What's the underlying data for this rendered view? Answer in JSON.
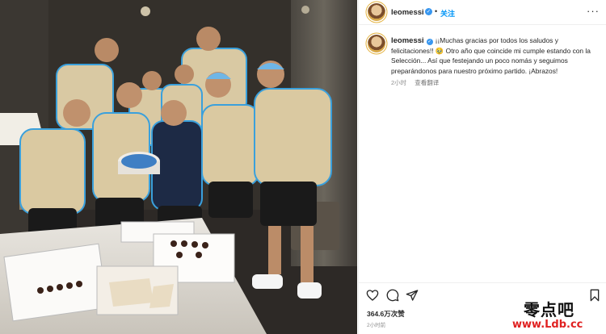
{
  "post": {
    "username": "leomessi",
    "follow_label": "关注",
    "more_label": "···",
    "caption_text": "¡¡Muchas gracias por todos los saludos y felicitaciones!! 🥹 Otro año que coincide mi cumple estando con la Selección... Así que festejando un poco nomás y seguimos preparándonos para nuestro próximo partido. ¡Abrazos!",
    "time_ago": "2小时",
    "translate_label": "查看翻译",
    "likes": "364.6万次赞",
    "time_full": "2小时前"
  },
  "icons": {
    "verified": "verified-badge-icon",
    "like": "heart-icon",
    "comment": "comment-icon",
    "share": "share-icon",
    "save": "bookmark-icon"
  },
  "colors": {
    "accent_blue": "#0095f6",
    "verified_blue": "#3897f0",
    "jersey": "#d9c9a3",
    "jersey_trim": "#3aa0dc",
    "watermark_red": "#e02020"
  },
  "watermark": {
    "cn": "零点吧",
    "url": "www.Ldb.cc"
  }
}
